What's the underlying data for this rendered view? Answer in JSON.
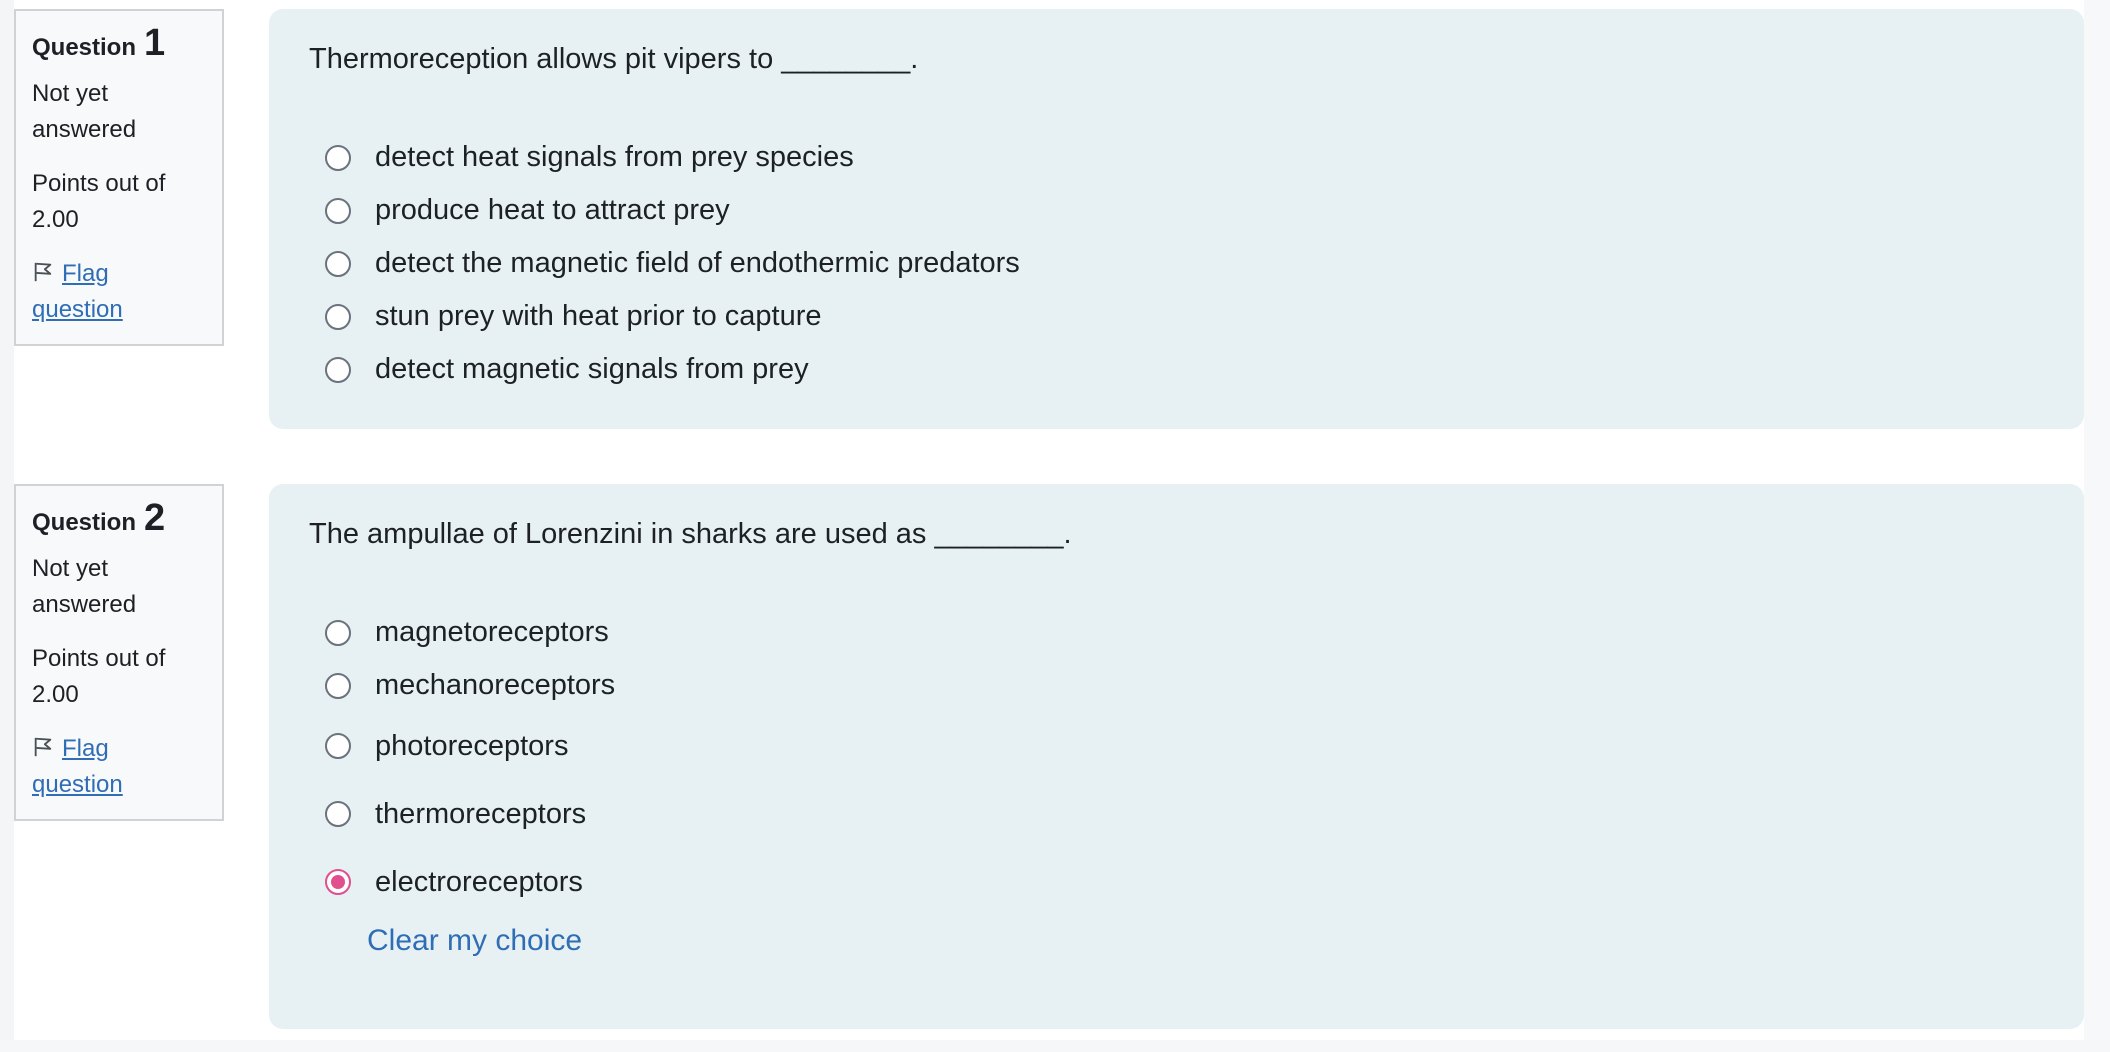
{
  "questions": [
    {
      "label": "Question",
      "number": "1",
      "state": "Not yet answered",
      "grade": "Points out of 2.00",
      "flag_label": "Flag question",
      "text": "Thermoreception allows pit vipers to ________.",
      "options": [
        {
          "label": "detect heat signals from prey species",
          "checked": false
        },
        {
          "label": "produce heat to attract prey",
          "checked": false
        },
        {
          "label": "detect the magnetic field of endothermic predators",
          "checked": false
        },
        {
          "label": "stun prey with heat prior to capture",
          "checked": false
        },
        {
          "label": "detect magnetic signals from prey",
          "checked": false
        }
      ]
    },
    {
      "label": "Question",
      "number": "2",
      "state": "Not yet answered",
      "grade": "Points out of 2.00",
      "flag_label": "Flag question",
      "text": "The ampullae of Lorenzini in sharks are used as ________.",
      "options": [
        {
          "label": "magnetoreceptors",
          "checked": false
        },
        {
          "label": "mechanoreceptors",
          "checked": false
        },
        {
          "label": "photoreceptors",
          "checked": false
        },
        {
          "label": "thermoreceptors",
          "checked": false
        },
        {
          "label": "electroreceptors",
          "checked": true
        }
      ],
      "clear_choice_label": "Clear my choice"
    }
  ],
  "colors": {
    "accent": "#2f6db5",
    "selected": "#e04f8f",
    "content_bg": "#e7f1f4"
  },
  "icons": {
    "flag": "flag-icon"
  }
}
